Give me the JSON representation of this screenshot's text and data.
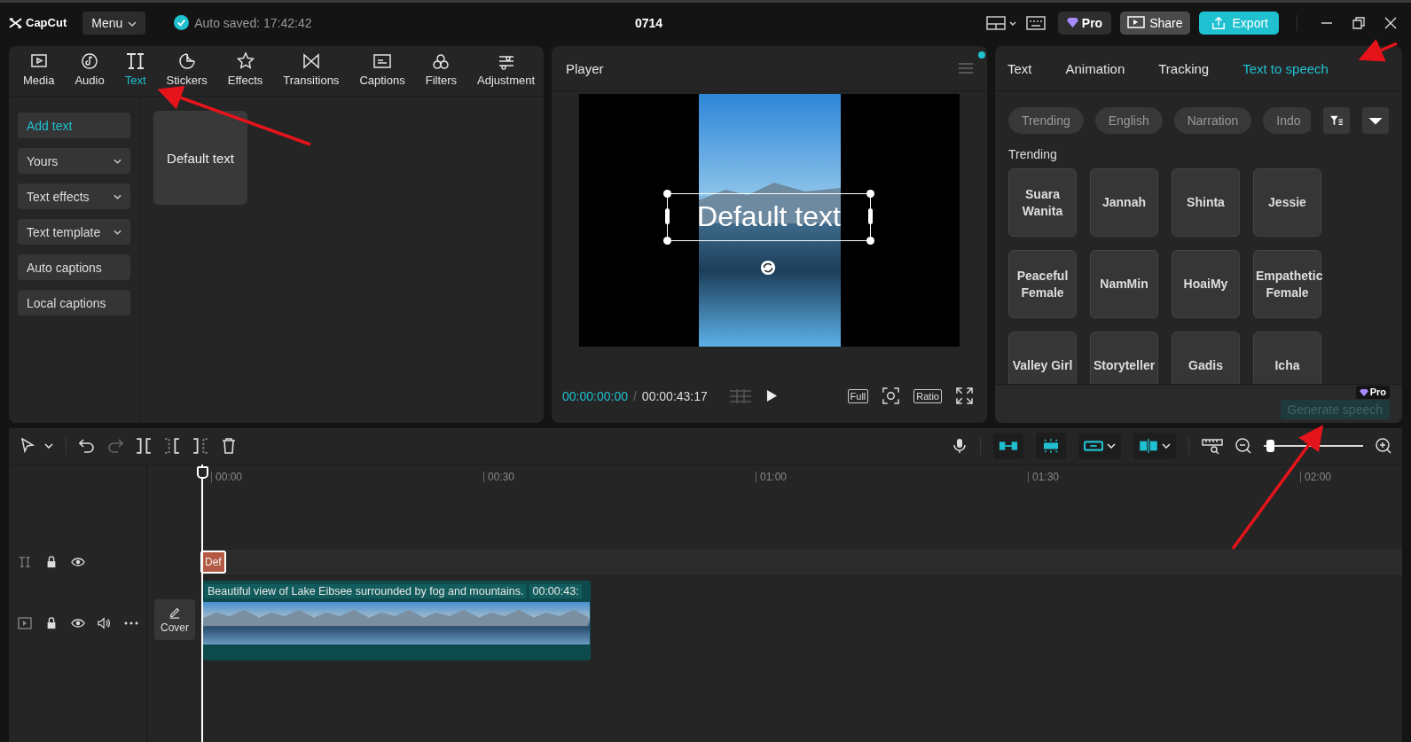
{
  "app": {
    "logo": "CapCut",
    "menu": "Menu",
    "autosave": "Auto saved: 17:42:42",
    "project_title": "0714",
    "pro": "Pro",
    "share": "Share",
    "export": "Export"
  },
  "toolbar": [
    {
      "label": "Media",
      "selected": false,
      "kind": "media"
    },
    {
      "label": "Audio",
      "selected": false,
      "kind": "audio"
    },
    {
      "label": "Text",
      "selected": true,
      "kind": "text"
    },
    {
      "label": "Stickers",
      "selected": false,
      "kind": "stickers"
    },
    {
      "label": "Effects",
      "selected": false,
      "kind": "effects"
    },
    {
      "label": "Transitions",
      "selected": false,
      "kind": "transitions"
    },
    {
      "label": "Captions",
      "selected": false,
      "kind": "captions"
    },
    {
      "label": "Filters",
      "selected": false,
      "kind": "filters"
    },
    {
      "label": "Adjustment",
      "selected": false,
      "kind": "adjustment"
    }
  ],
  "text_menu": [
    {
      "label": "Add text",
      "selected": true,
      "kind": "plain"
    },
    {
      "label": "Yours",
      "selected": false,
      "kind": "dropdown"
    },
    {
      "label": "Text effects",
      "selected": false,
      "kind": "dropdown"
    },
    {
      "label": "Text template",
      "selected": false,
      "kind": "dropdown"
    },
    {
      "label": "Auto captions",
      "selected": false,
      "kind": "plain"
    },
    {
      "label": "Local captions",
      "selected": false,
      "kind": "plain"
    }
  ],
  "preset": {
    "label": "Default text"
  },
  "player": {
    "title": "Player",
    "overlay_text": "Default text",
    "current_time": "00:00:00:00",
    "separator": "/",
    "duration": "00:00:43:17",
    "full": "Full",
    "ratio": "Ratio"
  },
  "inspector": {
    "tabs": [
      {
        "label": "Text",
        "selected": false
      },
      {
        "label": "Animation",
        "selected": false
      },
      {
        "label": "Tracking",
        "selected": false
      },
      {
        "label": "Text to speech",
        "selected": true
      }
    ],
    "filters": [
      "Trending",
      "English",
      "Narration",
      "Indo"
    ],
    "section": "Trending",
    "voices": [
      "Suara Wanita",
      "Jannah",
      "Shinta",
      "Jessie",
      "Peaceful Female",
      "NamMin",
      "HoaiMy",
      "Empathetic Female",
      "Valley Girl",
      "Storyteller",
      "Gadis",
      "Icha"
    ],
    "badge": "Pro",
    "generate": "Generate speech"
  },
  "timeline": {
    "ticks": [
      "00:00",
      "00:30",
      "01:00",
      "01:30",
      "02:00"
    ],
    "zoom": {
      "level": 0.03
    },
    "text_clip": "Def",
    "video_clip": {
      "title": "Beautiful view of Lake Eibsee surrounded by fog and mountains.",
      "duration": "00:00:43:"
    },
    "cover": "Cover"
  }
}
